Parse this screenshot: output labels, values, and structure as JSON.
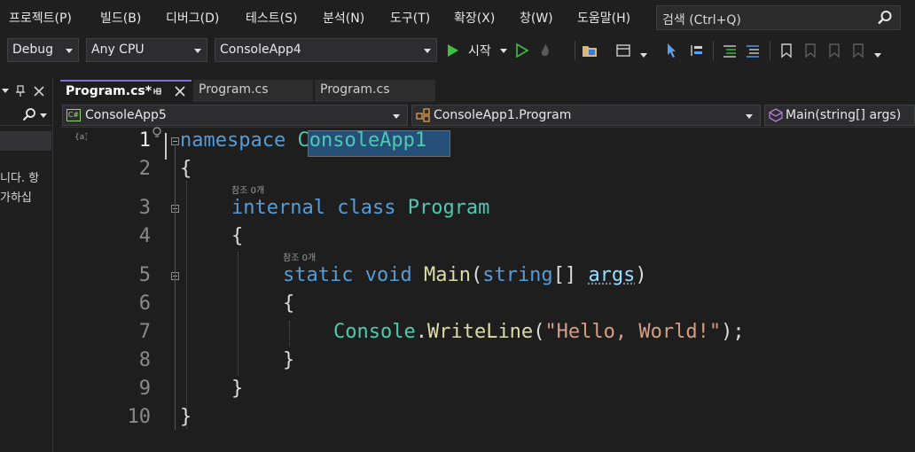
{
  "menu": {
    "items": [
      "프로젝트(P)",
      "빌드(B)",
      "디버그(D)",
      "테스트(S)",
      "분석(N)",
      "도구(T)",
      "확장(X)",
      "창(W)",
      "도움말(H)"
    ],
    "search_placeholder": "검색 (Ctrl+Q)"
  },
  "toolbar": {
    "config": "Debug",
    "platform": "Any CPU",
    "startup_project": "ConsoleApp4",
    "start_label": "시작"
  },
  "left_panel": {
    "text_lines": [
      "니다. 항",
      "가하십"
    ]
  },
  "tabs": [
    {
      "label": "Program.cs*",
      "active": true
    },
    {
      "label": "Program.cs",
      "active": false
    },
    {
      "label": "Program.cs",
      "active": false
    }
  ],
  "navbar": {
    "project": "ConsoleApp5",
    "project_badge": "C#",
    "type": "ConsoleApp1.Program",
    "member": "Main(string[] args)"
  },
  "editor": {
    "line_numbers": [
      "1",
      "2",
      "3",
      "4",
      "5",
      "6",
      "7",
      "8",
      "9",
      "10"
    ],
    "code_lens": [
      "참조 0개",
      "참조 0개"
    ],
    "code": {
      "l1_kw": "namespace",
      "l1_name": "ConsoleApp1",
      "l2": "{",
      "l3_kw1": "internal",
      "l3_kw2": "class",
      "l3_name": "Program",
      "l4": "{",
      "l5_kw1": "static",
      "l5_kw2": "void",
      "l5_fn": "Main",
      "l5_p1": "(",
      "l5_ty": "string",
      "l5_p2": "[]",
      "l5_arg": "args",
      "l5_p3": ")",
      "l6": "{",
      "l7_ty": "Console",
      "l7_dot": ".",
      "l7_fn": "WriteLine",
      "l7_p1": "(",
      "l7_str": "\"Hello, World!\"",
      "l7_p2": ");",
      "l8": "}",
      "l9": "}",
      "l10": "}"
    }
  },
  "colors": {
    "keyword": "#569cd6",
    "type": "#4ec9b0",
    "method": "#dcdcaa",
    "string": "#d69d85",
    "active_tab_accent": "#7f6fdb"
  },
  "icons": [
    "search-icon",
    "play-icon",
    "play-outline-icon",
    "hot-reload-icon",
    "folder-icon",
    "window-icon",
    "pointer-icon",
    "breakpoint-icon",
    "comment-icon",
    "uncomment-icon",
    "bookmark-icon",
    "pin-icon",
    "close-icon",
    "lightbulb-icon"
  ]
}
